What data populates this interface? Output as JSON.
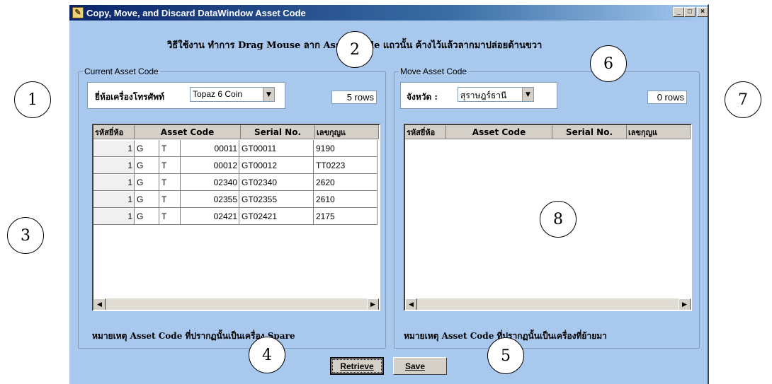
{
  "window": {
    "title": "Copy, Move, and Discard DataWindow Asset Code",
    "minimize": "_",
    "maximize": "□",
    "close": "×"
  },
  "instruction": "วิธีใช้งาน ทำการ Drag Mouse ลาก Asset Code แถวนั้น ค้างไว้แล้วลากมาปล่อยด้านขวา",
  "left_panel": {
    "group_label": "Current Asset Code",
    "filter_label": "ยี่ห้อเครื่องโทรศัพท์",
    "combo_value": "Topaz 6 Coin",
    "row_count": "5 rows",
    "columns": [
      "รหัสยี่ห้อ",
      "Asset Code",
      "Serial No.",
      "เลขกุญแ"
    ],
    "rows": [
      {
        "brand": "1",
        "c1": "G",
        "c2": "T",
        "code": "00011",
        "serial": "GT00011",
        "key": "9190"
      },
      {
        "brand": "1",
        "c1": "G",
        "c2": "T",
        "code": "00012",
        "serial": "GT00012",
        "key": "TT0223"
      },
      {
        "brand": "1",
        "c1": "G",
        "c2": "T",
        "code": "02340",
        "serial": "GT02340",
        "key": "2620"
      },
      {
        "brand": "1",
        "c1": "G",
        "c2": "T",
        "code": "02355",
        "serial": "GT02355",
        "key": "2610"
      },
      {
        "brand": "1",
        "c1": "G",
        "c2": "T",
        "code": "02421",
        "serial": "GT02421",
        "key": "2175"
      }
    ],
    "note": "หมายเหตุ Asset Code ที่ปรากฏนั้นเป็นเครื่อง Spare"
  },
  "right_panel": {
    "group_label": "Move Asset Code",
    "filter_label": "จังหวัด :",
    "combo_value": "สุราษฎร์ธานี",
    "row_count": "0 rows",
    "columns": [
      "รหัสยี่ห้อ",
      "Asset Code",
      "Serial No.",
      "เลขกุญแ"
    ],
    "note": "หมายเหตุ Asset Code ที่ปรากฏนั้นเป็นเครื่องที่ย้ายมา"
  },
  "buttons": {
    "retrieve": "Retrieve",
    "save": "Save"
  },
  "callouts": [
    "1",
    "2",
    "3",
    "4",
    "5",
    "6",
    "7",
    "8"
  ]
}
